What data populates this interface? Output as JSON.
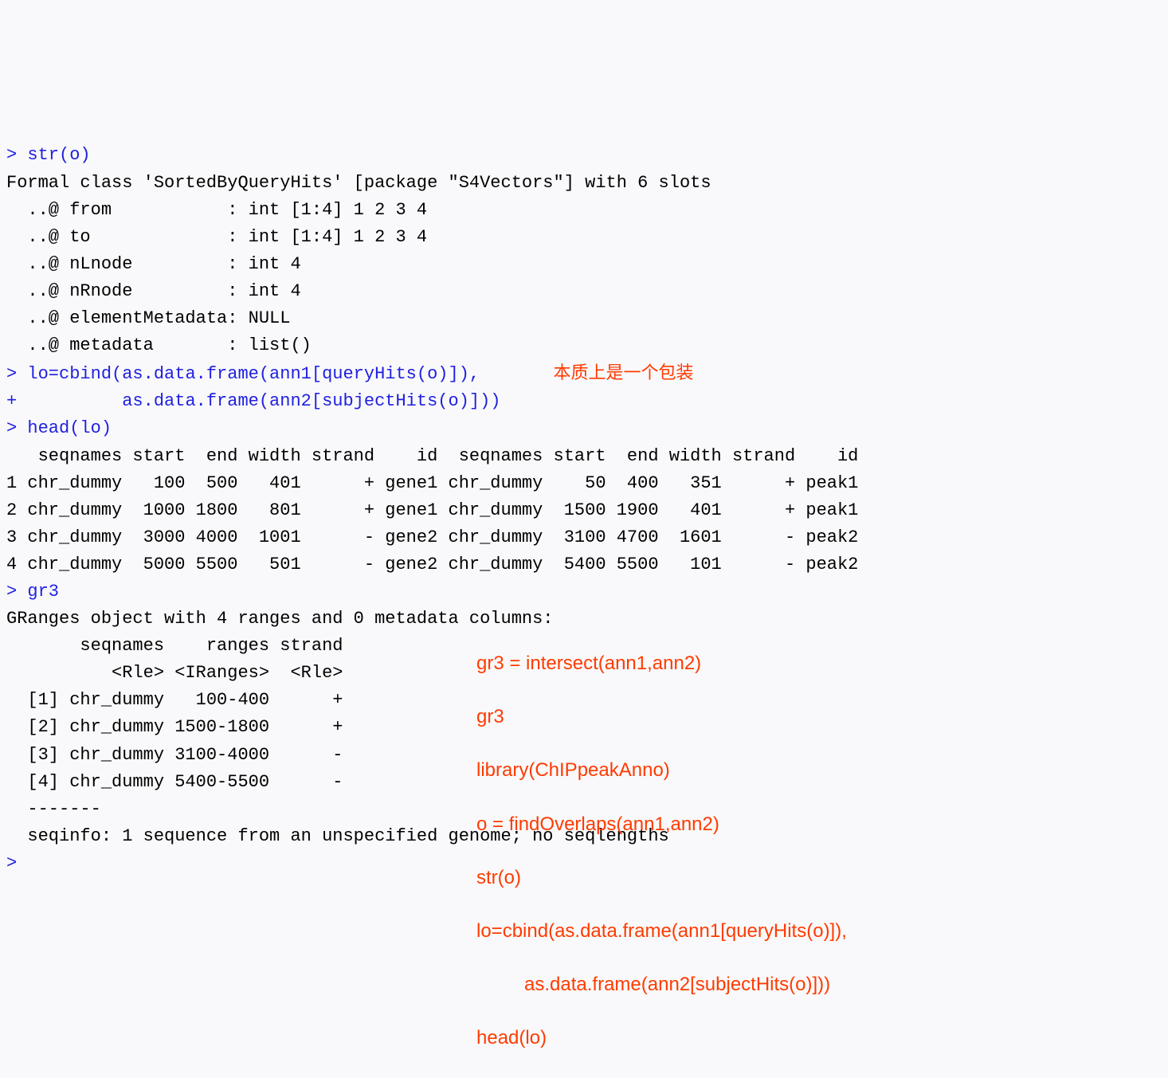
{
  "prompt": ">",
  "cont_prompt": "+",
  "lines": {
    "l1_cmd": "str(o)",
    "l2": "Formal class 'SortedByQueryHits' [package \"S4Vectors\"] with 6 slots",
    "l3": "  ..@ from           : int [1:4] 1 2 3 4",
    "l4": "  ..@ to             : int [1:4] 1 2 3 4",
    "l5": "  ..@ nLnode         : int 4",
    "l6": "  ..@ nRnode         : int 4",
    "l7": "  ..@ elementMetadata: NULL",
    "l8": "  ..@ metadata       : list()",
    "l9_cmd": "lo=cbind(as.data.frame(ann1[queryHits(o)]),",
    "l9_annot": "本质上是一个包装",
    "l10_cmd": "         as.data.frame(ann2[subjectHits(o)]))",
    "l11_cmd": "head(lo)",
    "l12": "   seqnames start  end width strand    id  seqnames start  end width strand    id",
    "l13": "1 chr_dummy   100  500   401      + gene1 chr_dummy    50  400   351      + peak1",
    "l14": "2 chr_dummy  1000 1800   801      + gene1 chr_dummy  1500 1900   401      + peak1",
    "l15": "3 chr_dummy  3000 4000  1001      - gene2 chr_dummy  3100 4700  1601      - peak2",
    "l16": "4 chr_dummy  5000 5500   501      - gene2 chr_dummy  5400 5500   101      - peak2",
    "l17_cmd": "gr3",
    "l18": "GRanges object with 4 ranges and 0 metadata columns:",
    "l19": "       seqnames    ranges strand",
    "l20": "          <Rle> <IRanges>  <Rle>",
    "l21": "  [1] chr_dummy   100-400      +",
    "l22": "  [2] chr_dummy 1500-1800      +",
    "l23": "  [3] chr_dummy 3100-4000      -",
    "l24": "  [4] chr_dummy 5400-5500      -",
    "l25": "  -------",
    "l26": "  seqinfo: 1 sequence from an unspecified genome; no seqlengths"
  },
  "overlay": {
    "o1": "gr3 = intersect(ann1,ann2)",
    "o2": "gr3",
    "o3": "library(ChIPpeakAnno)",
    "o4": "o = findOverlaps(ann1,ann2)",
    "o5": "str(o)",
    "o6": "lo=cbind(as.data.frame(ann1[queryHits(o)]),",
    "o7": "         as.data.frame(ann2[subjectHits(o)]))",
    "o8": "head(lo)"
  }
}
